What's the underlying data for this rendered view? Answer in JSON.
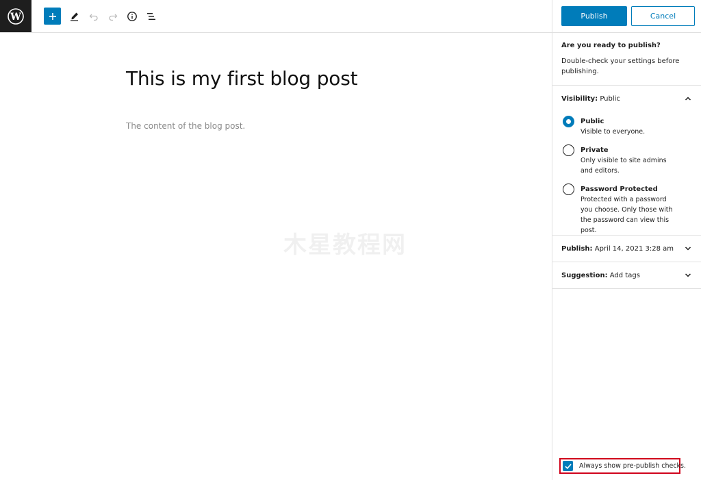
{
  "toolbar": {
    "logo_icon": "wordpress-logo",
    "icons": [
      "plus-icon",
      "pencil-icon",
      "undo-icon",
      "redo-icon",
      "info-icon",
      "list-view-icon"
    ]
  },
  "editor": {
    "title": "This is my first blog post",
    "content": "The content of the blog post.",
    "watermark": "木星教程网"
  },
  "sidebar": {
    "publish_label": "Publish",
    "cancel_label": "Cancel",
    "intro_heading": "Are you ready to publish?",
    "intro_text": "Double-check your settings before publishing.",
    "visibility": {
      "label": "Visibility:",
      "value": "Public",
      "options": [
        {
          "label": "Public",
          "help": "Visible to everyone.",
          "checked": true
        },
        {
          "label": "Private",
          "help": "Only visible to site admins and editors.",
          "checked": false
        },
        {
          "label": "Password Protected",
          "help": "Protected with a password you choose. Only those with the password can view this post.",
          "checked": false
        }
      ]
    },
    "publish_row": {
      "label": "Publish:",
      "value": "April 14, 2021 3:28 am"
    },
    "suggestion_row": {
      "label": "Suggestion:",
      "value": "Add tags"
    },
    "always_show_label": "Always show pre-publish checks.",
    "always_show_checked": true
  },
  "colors": {
    "accent": "#007cba",
    "highlight_box": "#d0021b",
    "logo_bg": "#1e1e1e"
  }
}
